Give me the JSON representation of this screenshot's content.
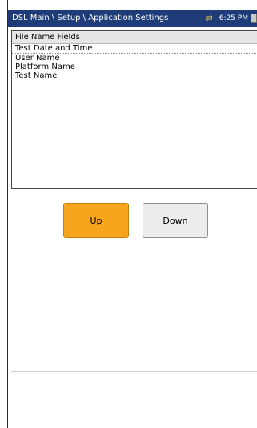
{
  "header": {
    "breadcrumb": "DSL Main \\ Setup \\ Application Settings",
    "clock": "6:25 PM",
    "transfer_icon": "transfer-arrows-icon",
    "battery_icon": "battery-icon"
  },
  "file_name_fields": {
    "header_label": "File Name Fields",
    "items": [
      "Test Date and Time",
      "User Name",
      "Platform Name",
      "Test Name"
    ]
  },
  "buttons": {
    "up_label": "Up",
    "down_label": "Down"
  },
  "colors": {
    "title_bar": "#1e3c78",
    "up_button": "#f7a51c",
    "down_button": "#ececec"
  }
}
